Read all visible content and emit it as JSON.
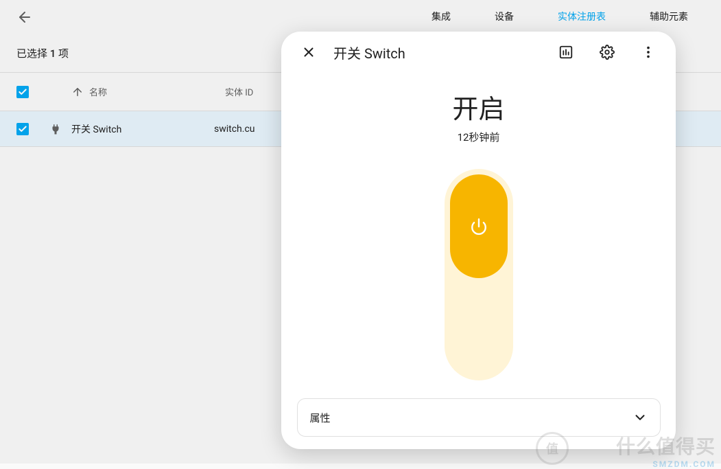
{
  "nav": {
    "tabs": [
      {
        "label": "集成",
        "active": false
      },
      {
        "label": "设备",
        "active": false
      },
      {
        "label": "实体注册表",
        "active": true
      },
      {
        "label": "辅助元素",
        "active": false
      }
    ]
  },
  "selection": {
    "text": "已选择 1 项"
  },
  "table": {
    "header": {
      "name": "名称",
      "entity_id": "实体 ID"
    },
    "rows": [
      {
        "name": "开关 Switch",
        "entity_id": "switch.cu"
      }
    ]
  },
  "dialog": {
    "title": "开关 Switch",
    "state": "开启",
    "time": "12秒钟前",
    "attributes_label": "属性"
  },
  "watermark": {
    "text": "什么值得买",
    "badge": "值",
    "sub": "SMZDM.COM"
  }
}
